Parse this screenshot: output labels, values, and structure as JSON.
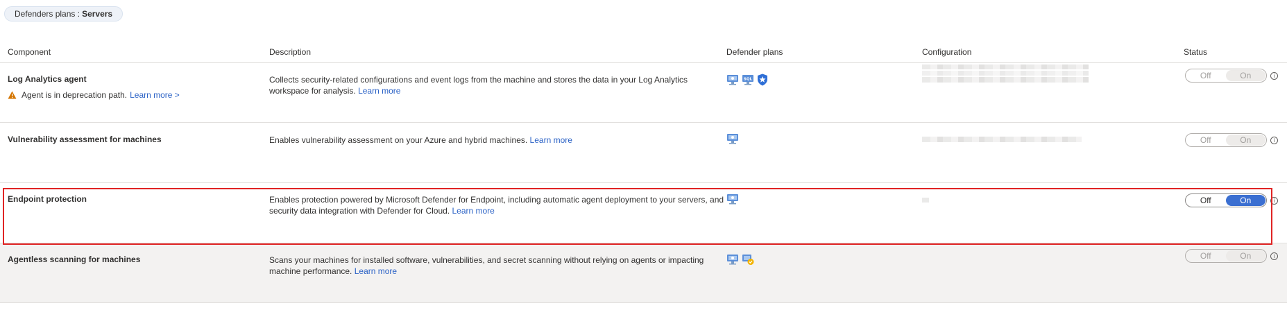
{
  "breadcrumb": {
    "prefix": "Defenders plans :",
    "current": "Servers"
  },
  "columns": {
    "component": "Component",
    "description": "Description",
    "plans": "Defender plans",
    "configuration": "Configuration",
    "status": "Status"
  },
  "rows": [
    {
      "name": "Log Analytics agent",
      "warning": "Agent is in deprecation path.",
      "warning_link": "Learn more >",
      "description": "Collects security-related configurations and event logs from the machine and stores the data in your Log Analytics workspace for analysis.",
      "link": "Learn more",
      "status_off": "Off",
      "status_on": "On",
      "plan_icons": [
        "server-plan-icon",
        "sql-plan-icon",
        "shield-plan-icon"
      ]
    },
    {
      "name": "Vulnerability assessment for machines",
      "description": "Enables vulnerability assessment on your Azure and hybrid machines.",
      "link": "Learn more",
      "status_off": "Off",
      "status_on": "On",
      "plan_icons": [
        "server-plan-icon"
      ]
    },
    {
      "name": "Endpoint protection",
      "description": "Enables protection powered by Microsoft Defender for Endpoint, including automatic agent deployment to your servers, and security data integration with Defender for Cloud.",
      "link": "Learn more",
      "status_off": "Off",
      "status_on": "On",
      "plan_icons": [
        "server-plan-icon"
      ]
    },
    {
      "name": "Agentless scanning for machines",
      "description": "Scans your machines for installed software, vulnerabilities, and secret scanning without relying on agents or impacting machine performance.",
      "link": "Learn more",
      "status_off": "Off",
      "status_on": "On",
      "plan_icons": [
        "server-plan-icon",
        "scan-plan-icon"
      ]
    }
  ],
  "colors": {
    "accent": "#3b6fd1",
    "link": "#2b62c6",
    "highlight": "#e02424",
    "warning": "#d47500"
  }
}
